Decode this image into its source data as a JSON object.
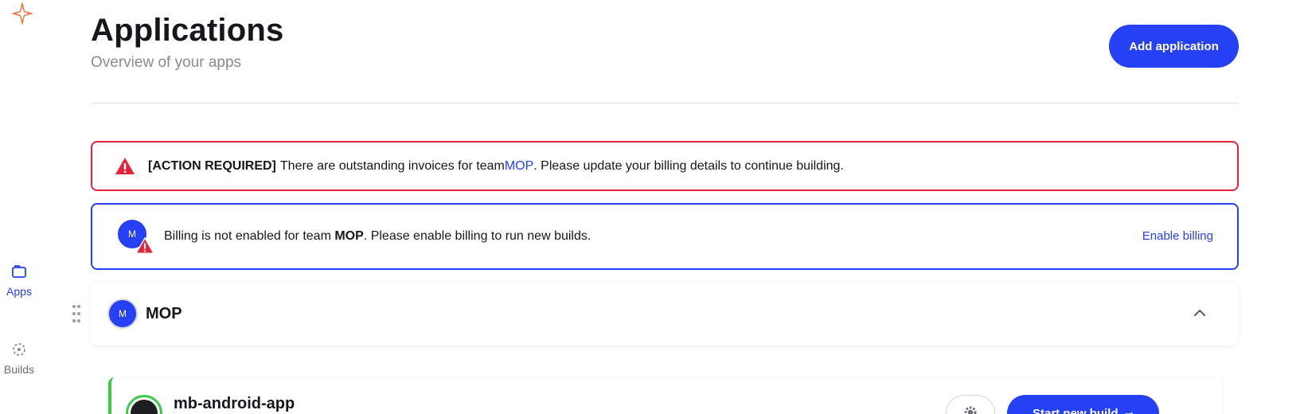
{
  "nav": {
    "apps_label": "Apps",
    "builds_label": "Builds"
  },
  "header": {
    "title": "Applications",
    "subtitle": "Overview of your apps",
    "add_button": "Add application"
  },
  "alerts": {
    "invoice": {
      "prefix": "[ACTION REQUIRED]",
      "text_before": "There are outstanding invoices for team ",
      "team": "MOP",
      "text_after": ". Please update your billing details to continue building."
    },
    "billing": {
      "avatar_initial": "M",
      "text_before": "Billing is not enabled for team ",
      "team": "MOP",
      "text_after": ". Please enable billing to run new builds.",
      "action": "Enable billing"
    }
  },
  "team": {
    "avatar_initial": "M",
    "name": "MOP"
  },
  "apps": [
    {
      "name": "mb-android-app",
      "start_build_label": "Start new build",
      "arrow": "→"
    }
  ],
  "colors": {
    "accent": "#2540f5",
    "danger": "#e8213b",
    "success": "#3ec84a"
  }
}
